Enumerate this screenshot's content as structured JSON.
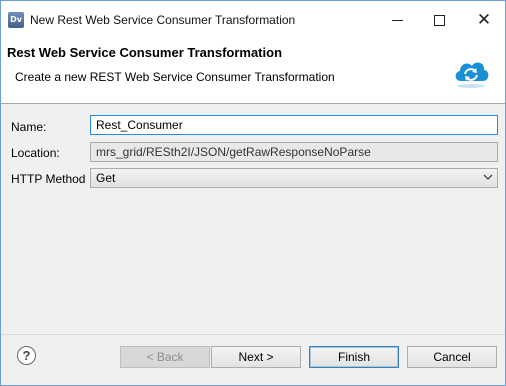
{
  "titlebar": {
    "app_icon_label": "Dv",
    "title": "New Rest Web Service Consumer Transformation",
    "controls": [
      "minimize-icon",
      "maximize-icon",
      "close-icon"
    ],
    "close_glyph": "✕"
  },
  "header": {
    "title": "Rest Web Service Consumer Transformation",
    "subtitle": "Create a new REST Web Service Consumer Transformation",
    "icon": "cloud-sync-icon"
  },
  "form": {
    "name_label": "Name:",
    "name_value": "Rest_Consumer",
    "location_label": "Location:",
    "location_value": "mrs_grid/RESth2I/JSON/getRawResponseNoParse",
    "method_label": "HTTP Method",
    "method_value": "Get"
  },
  "footer": {
    "help_glyph": "?",
    "back_label": "< Back",
    "next_label": "Next >",
    "finish_label": "Finish",
    "cancel_label": "Cancel"
  },
  "colors": {
    "window_border": "#6d9fd6",
    "input_focus_border": "#2a8ad8",
    "dialog_bg": "#f0f0f0",
    "cloud_blue": "#1a8fd6"
  }
}
